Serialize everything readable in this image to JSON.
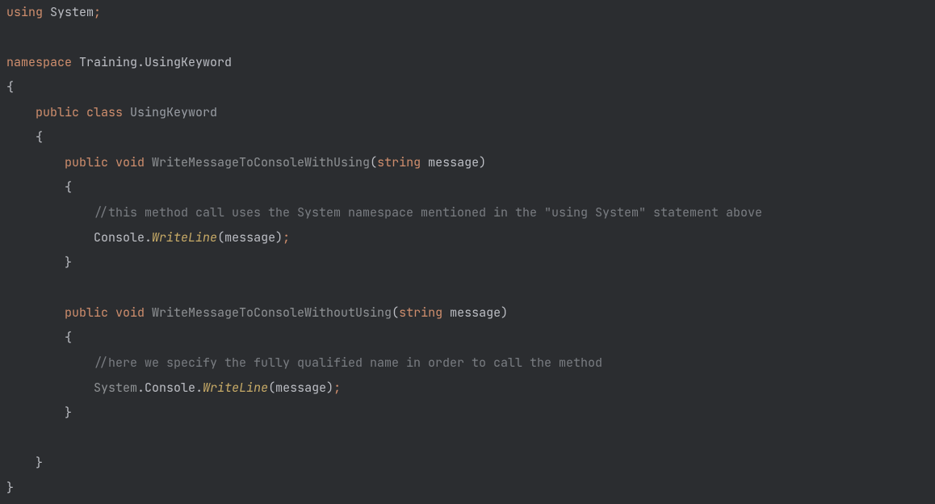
{
  "code": {
    "line1_using": "using",
    "line1_system": " System",
    "line1_semi": ";",
    "line3_namespace": "namespace",
    "line3_name": " Training.UsingKeyword",
    "line4_brace": "{",
    "line5_public": "    public",
    "line5_class": " class",
    "line5_name": " UsingKeyword",
    "line6_brace": "    {",
    "line7_public": "        public",
    "line7_void": " void",
    "line7_method": " WriteMessageToConsoleWithUsing",
    "line7_paren1": "(",
    "line7_string": "string",
    "line7_param": " message",
    "line7_paren2": ")",
    "line8_brace": "        {",
    "line9_comment": "            //this method call uses the System namespace mentioned in the \"using System\" statement above",
    "line10_indent": "            ",
    "line10_console": "Console",
    "line10_dot": ".",
    "line10_writeline": "WriteLine",
    "line10_paren1": "(",
    "line10_msg": "message",
    "line10_paren2": ")",
    "line10_semi": ";",
    "line11_brace": "        }",
    "line13_public": "        public",
    "line13_void": " void",
    "line13_method": " WriteMessageToConsoleWithoutUsing",
    "line13_paren1": "(",
    "line13_string": "string",
    "line13_param": " message",
    "line13_paren2": ")",
    "line14_brace": "        {",
    "line15_comment": "            //here we specify the fully qualified name in order to call the method",
    "line16_indent": "            ",
    "line16_system": "System",
    "line16_dot1": ".",
    "line16_console": "Console",
    "line16_dot2": ".",
    "line16_writeline": "WriteLine",
    "line16_paren1": "(",
    "line16_msg": "message",
    "line16_paren2": ")",
    "line16_semi": ";",
    "line17_brace": "        }",
    "line19_brace": "    }",
    "line20_brace": "}"
  }
}
